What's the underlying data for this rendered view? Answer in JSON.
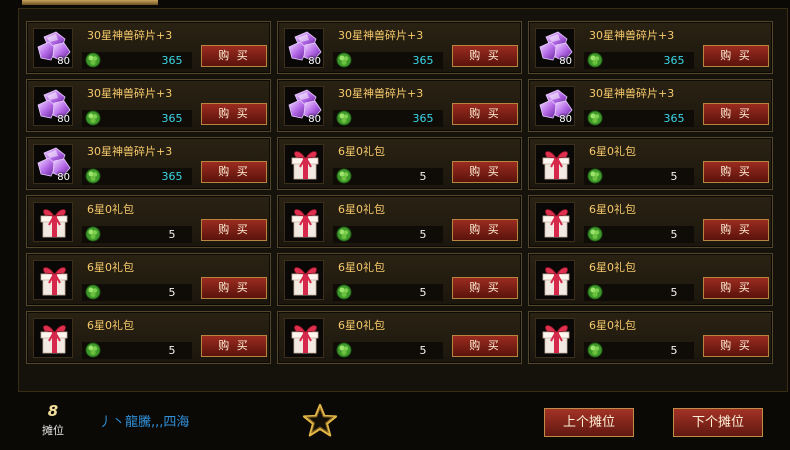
{
  "shop": {
    "slots": [
      {
        "name": "30星神兽碎片+3",
        "qty": "80",
        "price": "365",
        "icon": "purple-gem-icon",
        "price_color": "cyan"
      },
      {
        "name": "30星神兽碎片+3",
        "qty": "80",
        "price": "365",
        "icon": "purple-gem-icon",
        "price_color": "cyan"
      },
      {
        "name": "30星神兽碎片+3",
        "qty": "80",
        "price": "365",
        "icon": "purple-gem-icon",
        "price_color": "cyan"
      },
      {
        "name": "30星神兽碎片+3",
        "qty": "80",
        "price": "365",
        "icon": "purple-gem-icon",
        "price_color": "cyan"
      },
      {
        "name": "30星神兽碎片+3",
        "qty": "80",
        "price": "365",
        "icon": "purple-gem-icon",
        "price_color": "cyan"
      },
      {
        "name": "30星神兽碎片+3",
        "qty": "80",
        "price": "365",
        "icon": "purple-gem-icon",
        "price_color": "cyan"
      },
      {
        "name": "30星神兽碎片+3",
        "qty": "80",
        "price": "365",
        "icon": "purple-gem-icon",
        "price_color": "cyan"
      },
      {
        "name": "6星0礼包",
        "qty": "",
        "price": "5",
        "icon": "gift-box-icon",
        "price_color": "white"
      },
      {
        "name": "6星0礼包",
        "qty": "",
        "price": "5",
        "icon": "gift-box-icon",
        "price_color": "white"
      },
      {
        "name": "6星0礼包",
        "qty": "",
        "price": "5",
        "icon": "gift-box-icon",
        "price_color": "white"
      },
      {
        "name": "6星0礼包",
        "qty": "",
        "price": "5",
        "icon": "gift-box-icon",
        "price_color": "white"
      },
      {
        "name": "6星0礼包",
        "qty": "",
        "price": "5",
        "icon": "gift-box-icon",
        "price_color": "white"
      },
      {
        "name": "6星0礼包",
        "qty": "",
        "price": "5",
        "icon": "gift-box-icon",
        "price_color": "white"
      },
      {
        "name": "6星0礼包",
        "qty": "",
        "price": "5",
        "icon": "gift-box-icon",
        "price_color": "white"
      },
      {
        "name": "6星0礼包",
        "qty": "",
        "price": "5",
        "icon": "gift-box-icon",
        "price_color": "white"
      },
      {
        "name": "6星0礼包",
        "qty": "",
        "price": "5",
        "icon": "gift-box-icon",
        "price_color": "white"
      },
      {
        "name": "6星0礼包",
        "qty": "",
        "price": "5",
        "icon": "gift-box-icon",
        "price_color": "white"
      },
      {
        "name": "6星0礼包",
        "qty": "",
        "price": "5",
        "icon": "gift-box-icon",
        "price_color": "white"
      }
    ],
    "buy_label": "购 买",
    "currency_icon": "green-gem-coin-icon"
  },
  "footer": {
    "stall_number": "8",
    "stall_label": "摊位",
    "owner_name": "丿丶龍騰,,,四海",
    "favorite_icon": "star-outline-icon",
    "prev_label": "上个摊位",
    "next_label": "下个摊位"
  },
  "colors": {
    "accent_gold": "#f6c96b",
    "price_cyan": "#3ad6e6",
    "button_red": "#9b2b20",
    "owner_blue": "#2f8fd8"
  }
}
